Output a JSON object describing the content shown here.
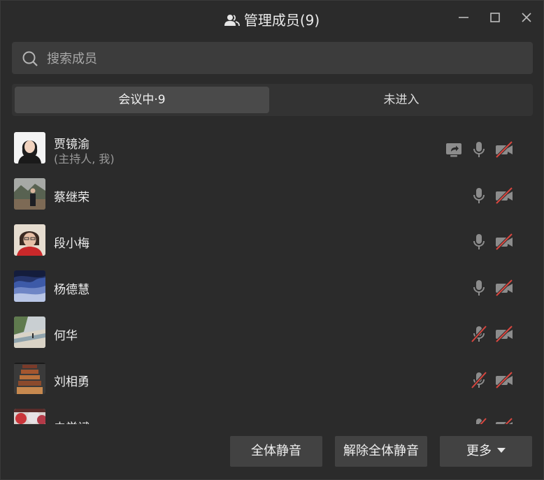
{
  "window": {
    "title": "管理成员(9)",
    "icons": {
      "title": "people-icon",
      "minimize": "minimize-icon",
      "maximize": "maximize-icon",
      "close": "close-icon"
    }
  },
  "search": {
    "placeholder": "搜索成员",
    "value": "",
    "icon": "search-icon"
  },
  "tabs": [
    {
      "label": "会议中·9",
      "active": true
    },
    {
      "label": "未进入",
      "active": false
    }
  ],
  "members": [
    {
      "name": "贾镜渝",
      "role": "(主持人, 我)",
      "sharing": true,
      "mic": "on",
      "video": "off"
    },
    {
      "name": "蔡继荣",
      "mic": "on",
      "video": "off"
    },
    {
      "name": "段小梅",
      "mic": "on",
      "video": "off"
    },
    {
      "name": "杨德慧",
      "mic": "on",
      "video": "off"
    },
    {
      "name": "何华",
      "mic": "muted",
      "video": "off"
    },
    {
      "name": "刘相勇",
      "mic": "muted",
      "video": "off"
    },
    {
      "name": "史学斌",
      "mic": "muted",
      "video": "off"
    }
  ],
  "footer": {
    "mute_all": "全体静音",
    "unmute_all": "解除全体静音",
    "more": "更多"
  },
  "colors": {
    "background": "#2b2b2b",
    "button": "#424242",
    "strike": "#d9463f",
    "icon": "#8c8c8c"
  }
}
